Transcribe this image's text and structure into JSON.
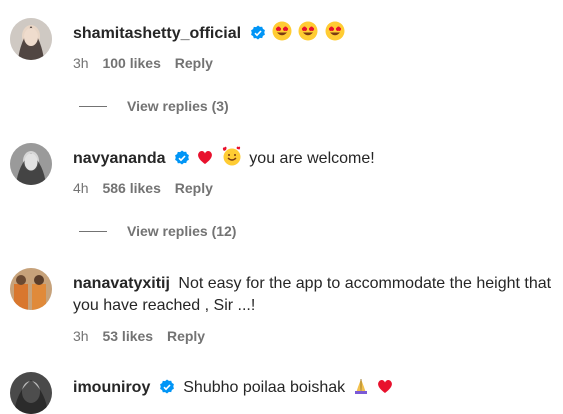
{
  "comments": [
    {
      "username": "shamitashetty_official",
      "verified": true,
      "emojis": [
        "heart-eyes-emoji",
        "heart-eyes-emoji",
        "heart-eyes-emoji"
      ],
      "text": "",
      "time": "3h",
      "likes": "100 likes",
      "reply": "Reply",
      "view_replies": "View replies (3)"
    },
    {
      "username": "navyananda",
      "verified": true,
      "emojis": [
        "red-heart-emoji",
        "smiling-face-with-hearts-emoji"
      ],
      "text": "you are welcome!",
      "time": "4h",
      "likes": "586 likes",
      "reply": "Reply",
      "view_replies": "View replies (12)"
    },
    {
      "username": "nanavatyxitij",
      "verified": false,
      "emojis": [],
      "text": "Not easy for the app to accommodate the height that you have reached , Sir ...!",
      "time": "3h",
      "likes": "53 likes",
      "reply": "Reply"
    },
    {
      "username": "imouniroy",
      "verified": true,
      "emojis_after_text": [
        "folded-hands-emoji",
        "red-heart-emoji"
      ],
      "text": "Shubho poilaa boishak"
    }
  ],
  "colors": {
    "verified_blue": "#0095f6",
    "meta_gray": "#737373",
    "heart_red": "#e8112d"
  }
}
